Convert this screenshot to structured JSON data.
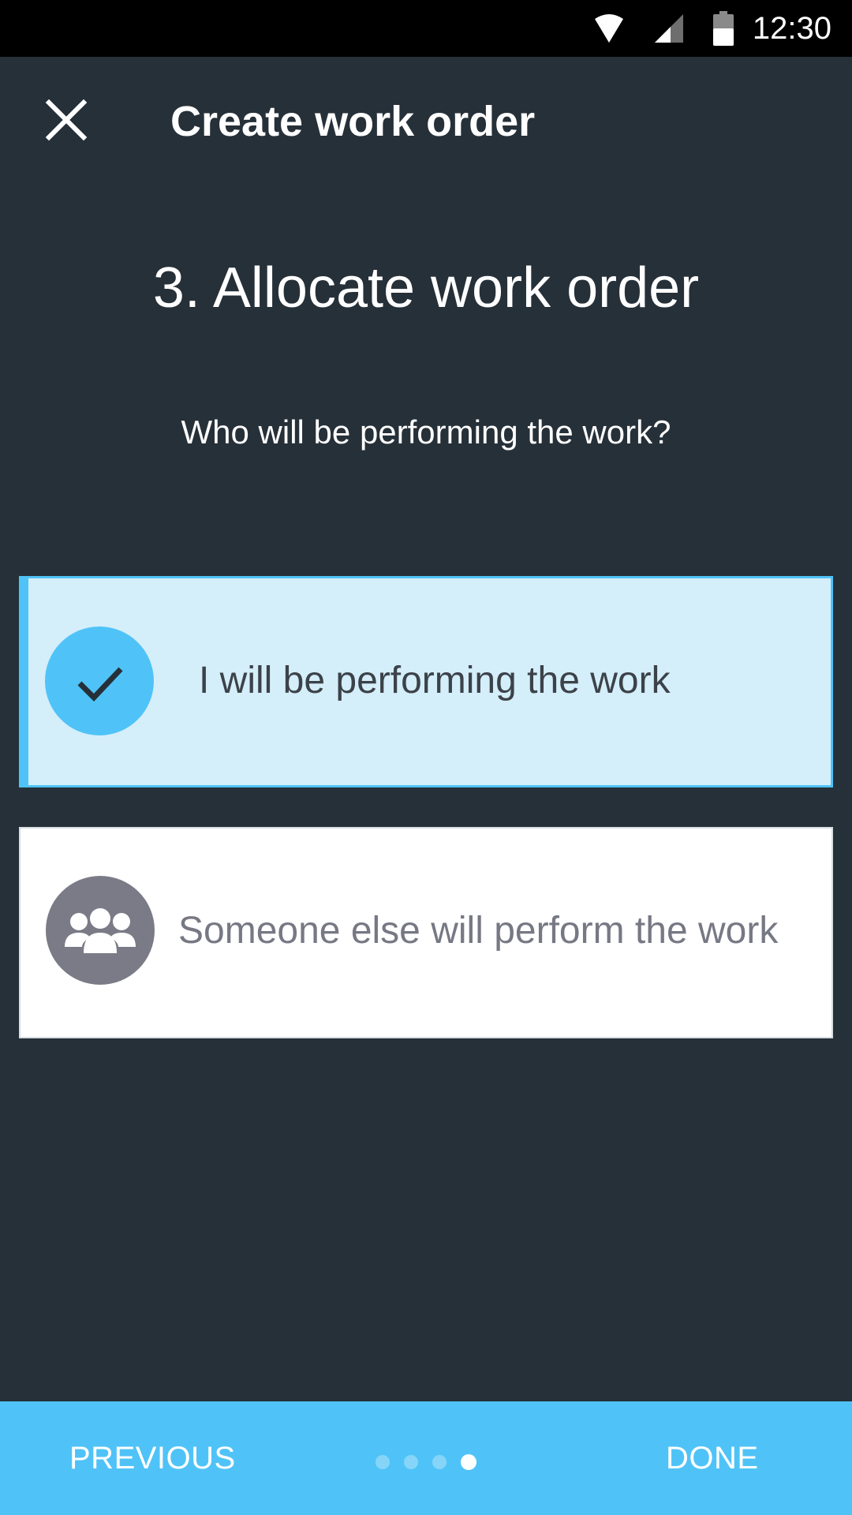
{
  "status_bar": {
    "time": "12:30",
    "icons": [
      "wifi-icon",
      "cell-signal-icon",
      "battery-icon"
    ]
  },
  "header": {
    "close_icon": "close-icon",
    "title": "Create work order"
  },
  "step": {
    "title": "3. Allocate work order",
    "question": "Who will be performing the work?"
  },
  "options": [
    {
      "label": "I will be performing the work",
      "icon": "check-icon",
      "selected": true
    },
    {
      "label": "Someone else will perform the work",
      "icon": "group-icon",
      "selected": false
    }
  ],
  "footer": {
    "previous_label": "PREVIOUS",
    "done_label": "DONE",
    "page_count": 4,
    "current_page": 4
  },
  "colors": {
    "background": "#263039",
    "accent": "#4fc3f7",
    "selected_card": "#d4eefa",
    "group_icon_bg": "#7a7b86"
  }
}
